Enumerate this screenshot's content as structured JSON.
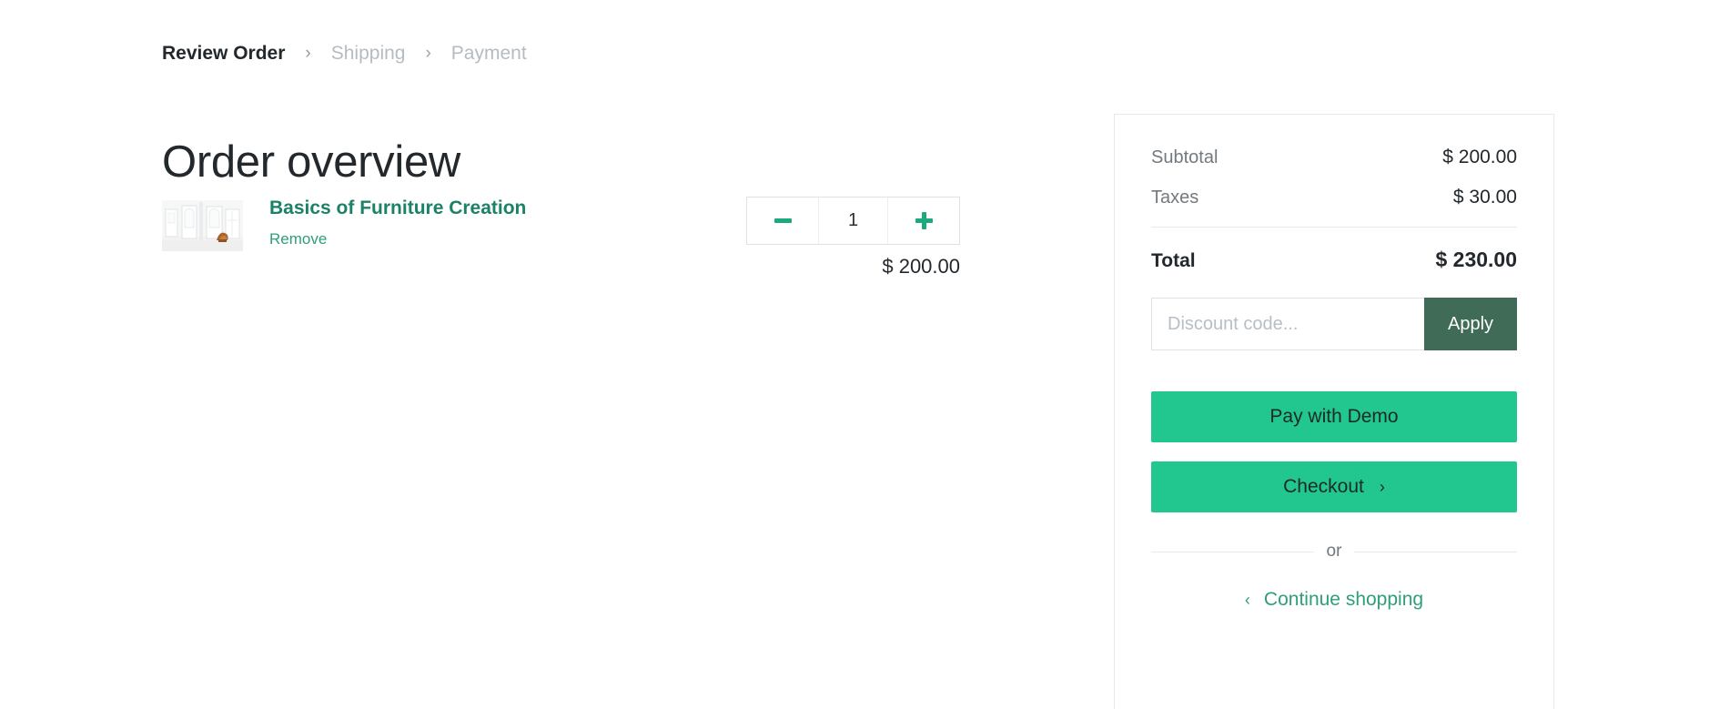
{
  "breadcrumb": {
    "steps": [
      {
        "label": "Review Order",
        "state": "active"
      },
      {
        "label": "Shipping",
        "state": "inactive"
      },
      {
        "label": "Payment",
        "state": "inactive"
      }
    ],
    "separator": "›"
  },
  "page": {
    "title": "Order overview"
  },
  "cart": {
    "items": [
      {
        "title": "Basics of Furniture Creation",
        "remove_label": "Remove",
        "quantity": "1",
        "price": "$ 200.00",
        "thumbnail_alt": "furniture-room-thumbnail"
      }
    ]
  },
  "summary": {
    "rows": [
      {
        "label": "Subtotal",
        "value": "$ 200.00"
      },
      {
        "label": "Taxes",
        "value": "$ 30.00"
      }
    ],
    "total": {
      "label": "Total",
      "value": "$ 230.00"
    },
    "discount": {
      "placeholder": "Discount code...",
      "value": "",
      "apply_label": "Apply"
    },
    "pay_label": "Pay with Demo",
    "checkout_label": "Checkout",
    "checkout_chevron": "›",
    "or_label": "or",
    "continue_label": "Continue shopping",
    "continue_chevron": "‹"
  },
  "colors": {
    "accent_green": "#22c78f",
    "link_green": "#2e9e7b",
    "title_green": "#1b8267",
    "apply_dark_green": "#3f6b57",
    "text_dark": "#23282d",
    "text_muted": "#72797f",
    "breadcrumb_inactive": "#b4bcc2",
    "border": "#e7eaec"
  }
}
